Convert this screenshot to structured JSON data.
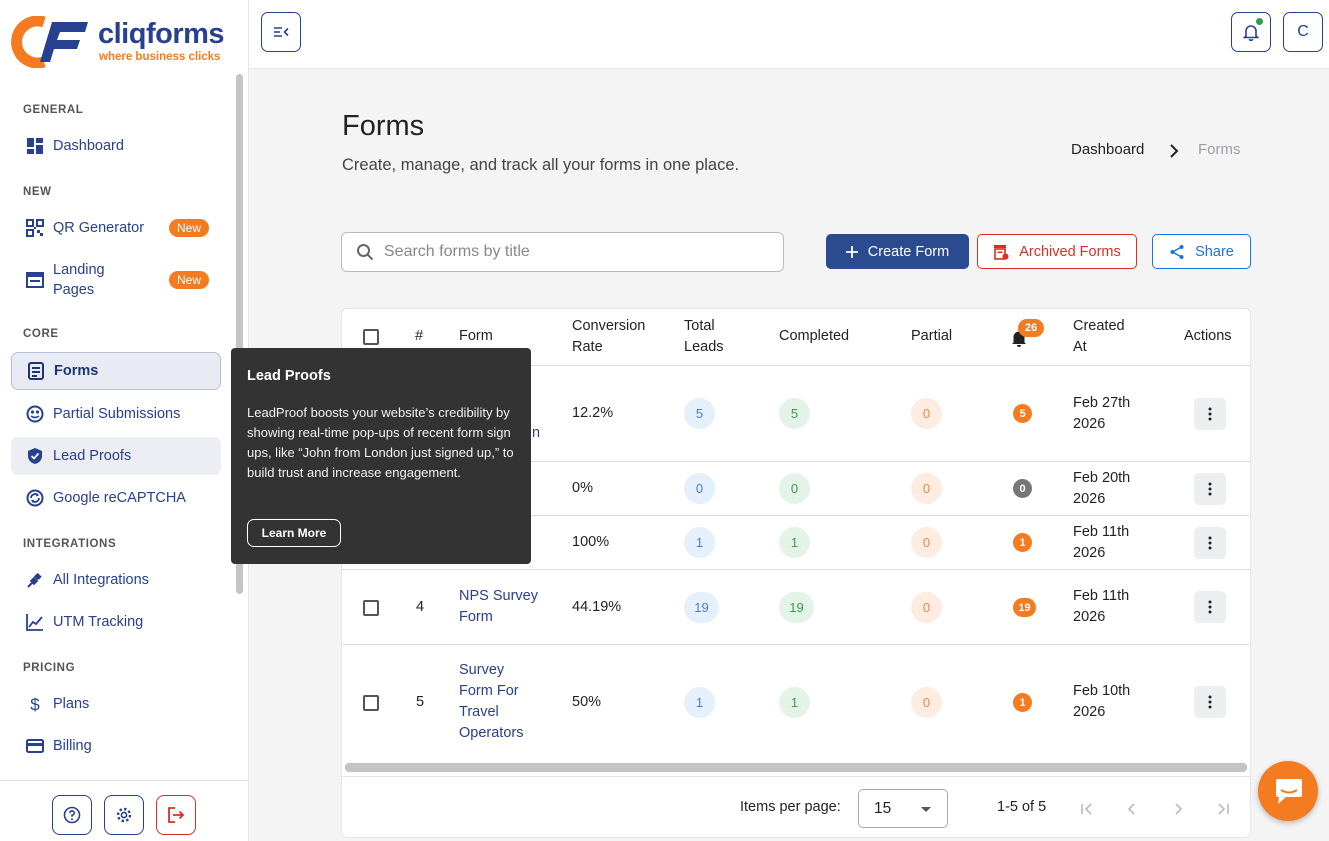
{
  "brand": {
    "name": "cliqforms",
    "tagline": "where business clicks",
    "primary": "#27408f",
    "accent": "#f47b20"
  },
  "sidebar": {
    "sections": {
      "general": "GENERAL",
      "new": "NEW",
      "core": "CORE",
      "integrations": "INTEGRATIONS",
      "pricing": "PRICING"
    },
    "items": {
      "dashboard": "Dashboard",
      "qr": "QR Generator",
      "landing": "Landing Pages",
      "forms": "Forms",
      "partial": "Partial Submissions",
      "leadproofs": "Lead Proofs",
      "recaptcha": "Google reCAPTCHA",
      "allint": "All Integrations",
      "utm": "UTM Tracking",
      "plans": "Plans",
      "billing": "Billing"
    },
    "new_badge": "New"
  },
  "topbar": {
    "avatar_initial": "C"
  },
  "page": {
    "title": "Forms",
    "subtitle": "Create, manage, and track all your forms in one place."
  },
  "breadcrumb": {
    "home": "Dashboard",
    "current": "Forms"
  },
  "toolbar": {
    "search_placeholder": "Search forms by title",
    "create": "Create Form",
    "archived": "Archived Forms",
    "share": "Share"
  },
  "table": {
    "headers": {
      "num": "#",
      "form": "Form",
      "conv1": "Conversion",
      "conv2": "Rate",
      "leads1": "Total",
      "leads2": "Leads",
      "completed": "Completed",
      "partial": "Partial",
      "notif": "26",
      "created1": "Created",
      "created2": "At",
      "actions": "Actions"
    },
    "rows": [
      {
        "num": "",
        "form": [
          "",
          "n"
        ],
        "rate": "12.2%",
        "leads": "5",
        "completed": "5",
        "partial": "0",
        "notif": "5",
        "date1": "Feb 27th",
        "date2": "2026"
      },
      {
        "num": "",
        "form": [],
        "rate": "0%",
        "leads": "0",
        "completed": "0",
        "partial": "0",
        "notif": "0",
        "date1": "Feb 20th",
        "date2": "2026"
      },
      {
        "num": "",
        "form": [],
        "rate": "100%",
        "leads": "1",
        "completed": "1",
        "partial": "0",
        "notif": "1",
        "date1": "Feb 11th",
        "date2": "2026"
      },
      {
        "num": "4",
        "form": [
          "NPS Survey",
          "Form"
        ],
        "rate": "44.19%",
        "leads": "19",
        "completed": "19",
        "partial": "0",
        "notif": "19",
        "date1": "Feb 11th",
        "date2": "2026"
      },
      {
        "num": "5",
        "form": [
          "Survey",
          "Form For",
          "Travel",
          "Operators"
        ],
        "rate": "50%",
        "leads": "1",
        "completed": "1",
        "partial": "0",
        "notif": "1",
        "date1": "Feb 10th",
        "date2": "2026"
      }
    ]
  },
  "pager": {
    "label": "Items per page:",
    "size": "15",
    "range": "1-5 of 5"
  },
  "tooltip": {
    "title": "Lead Proofs",
    "body": "LeadProof boosts your website’s credibility by showing real-time pop-ups of recent form sign ups, like “John from London just signed up,” to build trust and increase engagement.",
    "button": "Learn More"
  }
}
